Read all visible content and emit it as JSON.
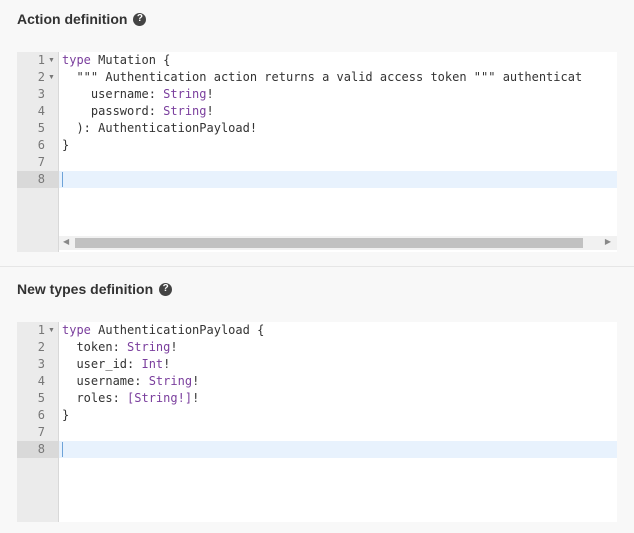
{
  "action_section": {
    "title": "Action definition",
    "help_icon": "question-circle-icon",
    "lines": [
      {
        "num": "1",
        "fold": "▼",
        "tokens": [
          {
            "t": "type ",
            "k": true
          },
          {
            "t": "Mutation {",
            "k": false
          }
        ]
      },
      {
        "num": "2",
        "fold": "▼",
        "tokens": [
          {
            "t": "  \"\"\" Authentication action returns a valid access token \"\"\" authenticat",
            "k": false
          }
        ]
      },
      {
        "num": "3",
        "fold": "",
        "tokens": [
          {
            "t": "    username: ",
            "k": false
          },
          {
            "t": "String",
            "k": true
          },
          {
            "t": "!",
            "k": false
          }
        ]
      },
      {
        "num": "4",
        "fold": "",
        "tokens": [
          {
            "t": "    password: ",
            "k": false
          },
          {
            "t": "String",
            "k": true
          },
          {
            "t": "!",
            "k": false
          }
        ]
      },
      {
        "num": "5",
        "fold": "",
        "tokens": [
          {
            "t": "  ): AuthenticationPayload!",
            "k": false
          }
        ]
      },
      {
        "num": "6",
        "fold": "",
        "tokens": [
          {
            "t": "}",
            "k": false
          }
        ]
      },
      {
        "num": "7",
        "fold": "",
        "tokens": []
      },
      {
        "num": "8",
        "fold": "",
        "tokens": []
      }
    ]
  },
  "types_section": {
    "title": "New types definition",
    "help_icon": "question-circle-icon",
    "lines": [
      {
        "num": "1",
        "fold": "▼",
        "tokens": [
          {
            "t": "type ",
            "k": true
          },
          {
            "t": "AuthenticationPayload {",
            "k": false
          }
        ]
      },
      {
        "num": "2",
        "fold": "",
        "tokens": [
          {
            "t": "  token: ",
            "k": false
          },
          {
            "t": "String",
            "k": true
          },
          {
            "t": "!",
            "k": false
          }
        ]
      },
      {
        "num": "3",
        "fold": "",
        "tokens": [
          {
            "t": "  user_id: ",
            "k": false
          },
          {
            "t": "Int",
            "k": true
          },
          {
            "t": "!",
            "k": false
          }
        ]
      },
      {
        "num": "4",
        "fold": "",
        "tokens": [
          {
            "t": "  username: ",
            "k": false
          },
          {
            "t": "String",
            "k": true
          },
          {
            "t": "!",
            "k": false
          }
        ]
      },
      {
        "num": "5",
        "fold": "",
        "tokens": [
          {
            "t": "  roles: ",
            "k": false
          },
          {
            "t": "[String!]",
            "k": true
          },
          {
            "t": "!",
            "k": false
          }
        ]
      },
      {
        "num": "6",
        "fold": "",
        "tokens": [
          {
            "t": "}",
            "k": false
          }
        ]
      },
      {
        "num": "7",
        "fold": "",
        "tokens": []
      },
      {
        "num": "8",
        "fold": "",
        "tokens": []
      }
    ]
  },
  "scroll": {
    "left_arrow": "◀",
    "right_arrow": "▶"
  }
}
